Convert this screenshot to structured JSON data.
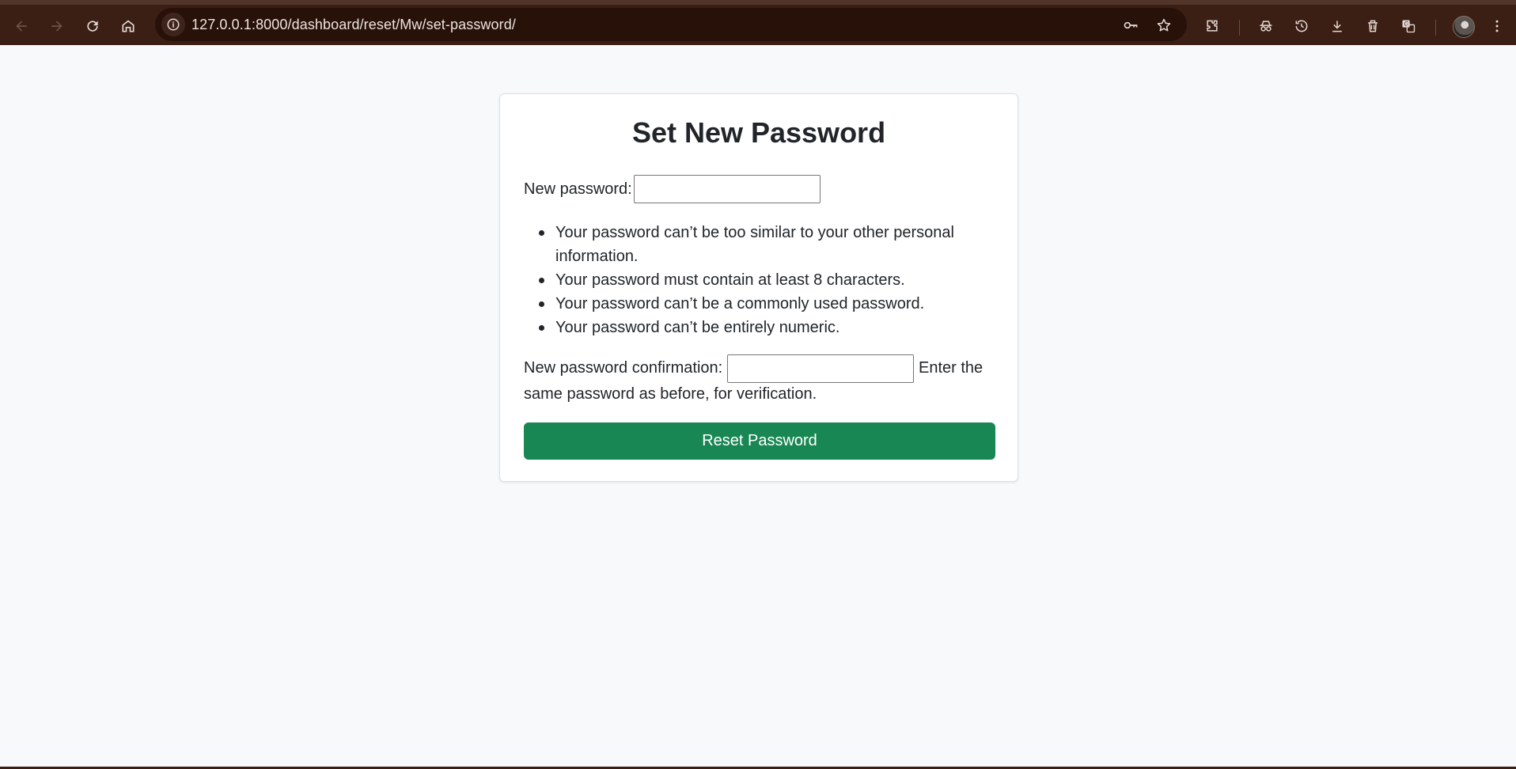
{
  "browser": {
    "url": "127.0.0.1:8000/dashboard/reset/Mw/set-password/",
    "icons": [
      "back-icon",
      "forward-icon",
      "reload-icon",
      "home-icon",
      "info-icon",
      "key-icon",
      "star-icon",
      "extensions-icon",
      "incognito-icon",
      "history-icon",
      "download-icon",
      "trash-icon",
      "translate-icon",
      "profile-avatar",
      "more-icon"
    ]
  },
  "page": {
    "title": "Set New Password",
    "new_password_label": "New password:",
    "rules": [
      "Your password can’t be too similar to your other personal information.",
      "Your password must contain at least 8 characters.",
      "Your password can’t be a commonly used password.",
      "Your password can’t be entirely numeric."
    ],
    "confirm_label": "New password confirmation:",
    "confirm_help_part1": "Enter the",
    "confirm_help_part2": "same password as before, for verification.",
    "submit_label": "Reset Password",
    "new_password_value": "",
    "confirm_value": ""
  },
  "colors": {
    "chrome_bg": "#3b1f14",
    "omnibox_bg": "#271109",
    "page_bg": "#f8f9fa",
    "button_bg": "#198754",
    "text": "#212529"
  }
}
